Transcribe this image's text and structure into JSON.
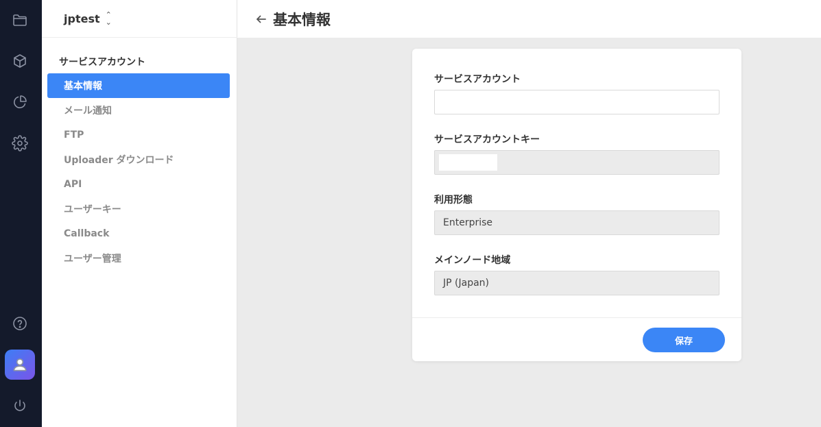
{
  "rail": {
    "icons": [
      "folder-icon",
      "cube-icon",
      "pie-chart-icon",
      "gear-icon",
      "help-icon",
      "user-icon",
      "power-icon"
    ]
  },
  "sidebar": {
    "project_name": "jptest",
    "section_title": "サービスアカウント",
    "items": [
      {
        "label": "基本情報",
        "active": true
      },
      {
        "label": "メール通知",
        "active": false
      },
      {
        "label": "FTP",
        "active": false
      },
      {
        "label": "Uploader ダウンロード",
        "active": false
      },
      {
        "label": "API",
        "active": false
      },
      {
        "label": "ユーザーキー",
        "active": false
      },
      {
        "label": "Callback",
        "active": false
      },
      {
        "label": "ユーザー管理",
        "active": false
      }
    ]
  },
  "header": {
    "title": "基本情報"
  },
  "form": {
    "service_account": {
      "label": "サービスアカウント",
      "value": ""
    },
    "service_account_key": {
      "label": "サービスアカウントキー",
      "value": ""
    },
    "usage_type": {
      "label": "利用形態",
      "value": "Enterprise"
    },
    "main_node_region": {
      "label": "メインノード地域",
      "value": "JP (Japan)"
    },
    "save_label": "保存"
  },
  "colors": {
    "rail_bg": "#141a2b",
    "accent": "#3b86f6",
    "readonly_bg": "#ebebeb"
  }
}
